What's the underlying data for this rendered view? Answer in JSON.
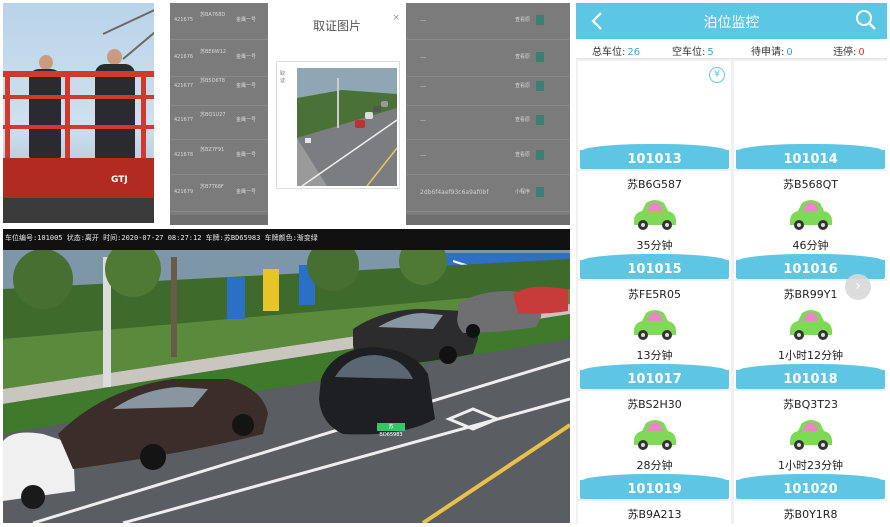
{
  "camera": {
    "caption": "车位编号:101005 状态:离开 时间:2020-07-27 08:27:12 车牌:苏BD65983 车牌颜色:渐变绿",
    "plate_text": "苏BD65983",
    "photo_lift_label": "GTJ"
  },
  "evidence_modal": {
    "title": "取证图片",
    "close": "×",
    "side_label": "取证"
  },
  "backdrop_table": {
    "rows": [
      {
        "id": "421675",
        "plate": "苏BA768D",
        "road": "金鹰一号",
        "dash": "—",
        "status": "查看原"
      },
      {
        "id": "421676",
        "plate": "苏BE6W12",
        "road": "金鹰一号",
        "dash": "—",
        "status": "查看原"
      },
      {
        "id": "421677",
        "plate": "苏B5D6T8",
        "road": "金鹰一号",
        "dash": "—",
        "status": "查看原"
      },
      {
        "id": "421677",
        "plate": "苏BQ1U27",
        "road": "金鹰一号",
        "dash": "—",
        "status": "查看原"
      },
      {
        "id": "421678",
        "plate": "苏BZ7F91",
        "road": "金鹰一号",
        "dash": "—",
        "status": "查看原"
      },
      {
        "id": "421679",
        "plate": "苏B7T68F",
        "road": "金鹰一号",
        "dash": "2db6f4aef93c6a9af0bf",
        "status": "小程序"
      }
    ]
  },
  "app": {
    "title": "泊位监控",
    "stats": {
      "total_label": "总车位:",
      "total_value": "26",
      "empty_label": "空车位:",
      "empty_value": "5",
      "pending_label": "待申请:",
      "pending_value": "0",
      "violation_label": "违停:",
      "violation_value": "0"
    },
    "colors": {
      "accent": "#5bc7e4",
      "total": "#3a9fd6",
      "violation": "#e53935",
      "car_body": "#7ed957",
      "car_roof": "#e889c5"
    },
    "slots": [
      {
        "number": "101013",
        "plate": "",
        "time": "",
        "empty": true,
        "fee_icon": "¥"
      },
      {
        "number": "101014",
        "plate": "",
        "time": "",
        "empty": true,
        "fee_icon": ""
      },
      {
        "number": "101015",
        "plate": "苏B6G587",
        "time": "35分钟",
        "empty": false
      },
      {
        "number": "101016",
        "plate": "苏B568QT",
        "time": "46分钟",
        "empty": false
      },
      {
        "number": "101017",
        "plate": "苏FE5R05",
        "time": "13分钟",
        "empty": false
      },
      {
        "number": "101018",
        "plate": "苏BR99Y1",
        "time": "1小时12分钟",
        "empty": false
      },
      {
        "number": "101019",
        "plate": "苏BS2H30",
        "time": "28分钟",
        "empty": false
      },
      {
        "number": "101020",
        "plate": "苏BQ3T23",
        "time": "1小时23分钟",
        "empty": false
      },
      {
        "number": "",
        "plate": "苏B9A213",
        "time": "",
        "empty": false
      },
      {
        "number": "",
        "plate": "苏B0Y1R8",
        "time": "",
        "empty": false
      }
    ],
    "scroll_hint": "›"
  }
}
